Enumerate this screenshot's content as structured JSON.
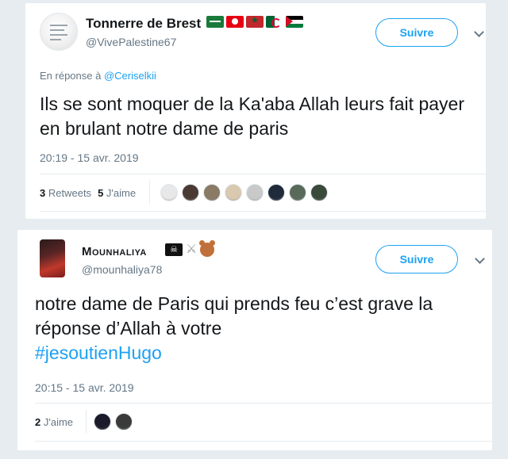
{
  "tweets": [
    {
      "display_name": "Tonnerre de Brest",
      "flags": [
        "saudi-arabia-flag",
        "tunisia-flag",
        "morocco-flag",
        "algeria-flag",
        "palestine-flag"
      ],
      "handle": "@VivePalestine67",
      "follow_label": "Suivre",
      "reply_prefix": "En réponse à",
      "reply_mention": "@Ceriselkii",
      "text": "Ils se sont moquer de la Ka'aba Allah leurs fait payer en brulant notre dame de paris",
      "timestamp": "20:19 - 15 avr. 2019",
      "retweets_count": "3",
      "retweets_label": "Retweets",
      "likes_count": "5",
      "likes_label": "J'aime",
      "liker_colors": [
        "#e8e8e8",
        "#4a3a32",
        "#8a7a66",
        "#d9c9b0",
        "#c9c9c9",
        "#1f2a3a",
        "#5a6a5a",
        "#3a4a3a"
      ]
    },
    {
      "display_name": "Mounhaliya",
      "flags": [
        "pirate-flag-emoji",
        "crossed-swords-emoji",
        "teddy-bear-emoji"
      ],
      "handle": "@mounhaliya78",
      "follow_label": "Suivre",
      "text": "notre dame de Paris qui prends feu c’est grave la réponse d’Allah à votre",
      "hashtag": "#jesoutienHugo",
      "timestamp": "20:15 - 15 avr. 2019",
      "likes_count": "2",
      "likes_label": "J'aime",
      "liker_colors": [
        "#1a1a2a",
        "#3a3a3a"
      ]
    }
  ],
  "colors": {
    "accent": "#1da1f2",
    "secondary_text": "#657786",
    "background": "#e6ecf0"
  }
}
